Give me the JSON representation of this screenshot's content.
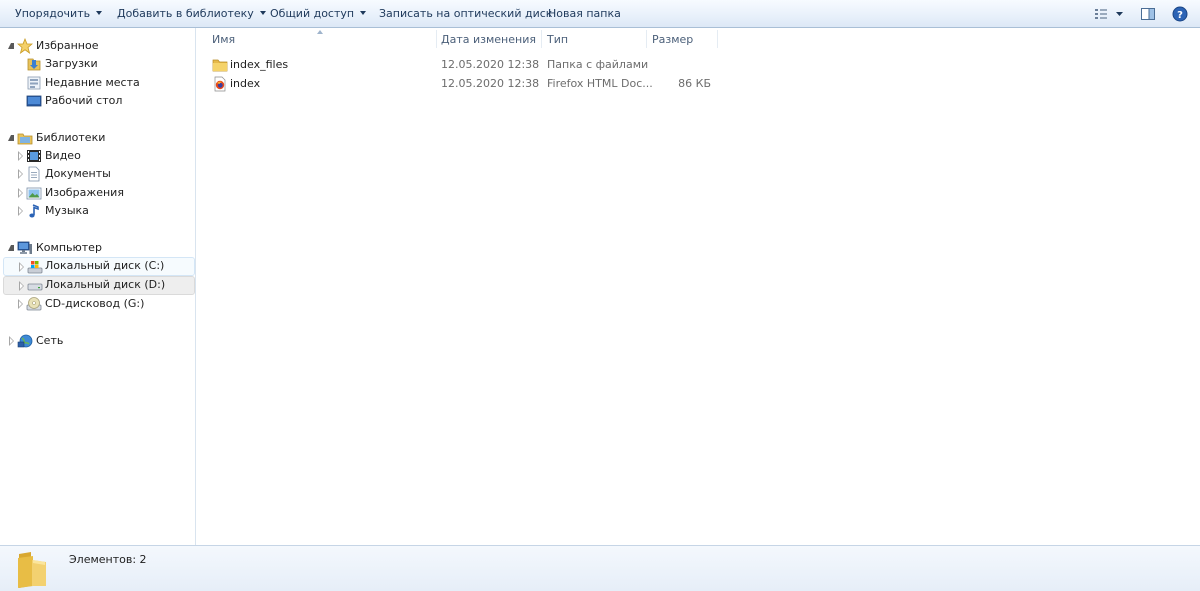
{
  "toolbar": {
    "organize_label": "Упорядочить",
    "add_to_library_label": "Добавить в библиотеку",
    "share_label": "Общий доступ",
    "burn_label": "Записать на оптический диск",
    "new_folder_label": "Новая папка",
    "icons": [
      "view-options-icon",
      "preview-pane-icon",
      "help-icon"
    ]
  },
  "nav": {
    "favorites": {
      "label": "Избранное",
      "icon": "star-icon",
      "items": [
        {
          "label": "Загрузки",
          "icon": "downloads-icon"
        },
        {
          "label": "Недавние места",
          "icon": "recent-places-icon"
        },
        {
          "label": "Рабочий стол",
          "icon": "desktop-icon"
        }
      ]
    },
    "libraries": {
      "label": "Библиотеки",
      "icon": "libraries-icon",
      "items": [
        {
          "label": "Видео",
          "icon": "video-icon"
        },
        {
          "label": "Документы",
          "icon": "documents-icon"
        },
        {
          "label": "Изображения",
          "icon": "pictures-icon"
        },
        {
          "label": "Музыка",
          "icon": "music-icon"
        }
      ]
    },
    "computer": {
      "label": "Компьютер",
      "icon": "computer-icon",
      "items": [
        {
          "label": "Локальный диск (C:)",
          "icon": "system-drive-icon"
        },
        {
          "label": "Локальный диск (D:)",
          "icon": "drive-icon"
        },
        {
          "label": "CD-дисковод (G:)",
          "icon": "cd-drive-icon"
        }
      ]
    },
    "network": {
      "label": "Сеть",
      "icon": "network-icon"
    }
  },
  "columns": {
    "name": "Имя",
    "date": "Дата изменения",
    "type": "Тип",
    "size": "Размер"
  },
  "files": [
    {
      "name": "index_files",
      "date": "12.05.2020 12:38",
      "type": "Папка с файлами",
      "size": "",
      "icon": "folder-icon"
    },
    {
      "name": "index",
      "date": "12.05.2020 12:38",
      "type": "Firefox HTML Doc...",
      "size": "86 КБ",
      "icon": "firefox-html-icon"
    }
  ],
  "status": {
    "count_text": "Элементов: 2",
    "icon": "folder-large-icon"
  },
  "colors": {
    "toolbar_text": "#1e395b",
    "header_text": "#4c607a",
    "folder_yellow": "#f5d36a"
  }
}
